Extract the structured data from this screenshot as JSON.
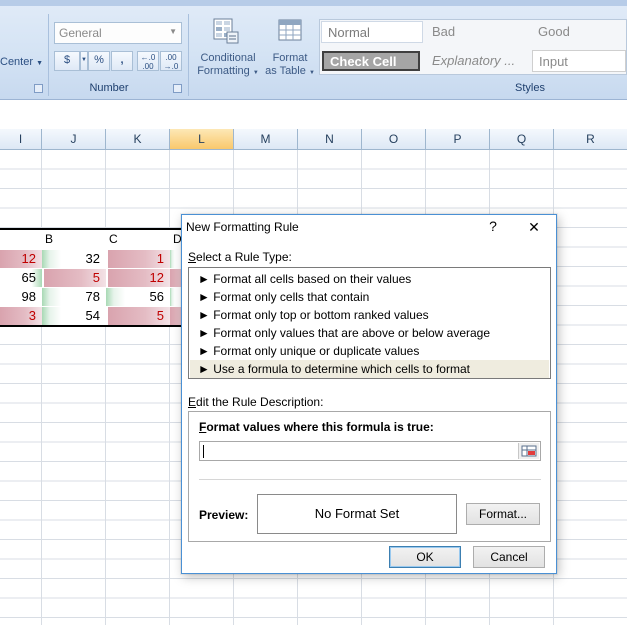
{
  "ribbon": {
    "alignment": {
      "center_label": "Center"
    },
    "number": {
      "format_value": "General",
      "currency_symbol": "$",
      "percent_symbol": "%",
      "comma_symbol": ",",
      "increase_decimal": "←.0 .00",
      "decrease_decimal": ".00 →.0",
      "group_label": "Number"
    },
    "conditional_formatting": {
      "line1": "Conditional",
      "line2": "Formatting"
    },
    "format_as_table": {
      "line1": "Format",
      "line2": "as Table"
    },
    "styles": {
      "normal": "Normal",
      "bad": "Bad",
      "good": "Good",
      "check_cell": "Check Cell",
      "explanatory": "Explanatory ...",
      "input": "Input",
      "group_label": "Styles"
    }
  },
  "sheet": {
    "columns": [
      "I",
      "J",
      "K",
      "L",
      "M",
      "N",
      "O",
      "P",
      "Q",
      "R"
    ],
    "selected_column": "L",
    "table_headers": [
      "B",
      "C",
      "D"
    ],
    "rows": [
      {
        "c1": "12",
        "c2": "32",
        "c3": "1"
      },
      {
        "c1": "65",
        "c2": "5",
        "c3": "12"
      },
      {
        "c1": "98",
        "c2": "78",
        "c3": "56"
      },
      {
        "c1": "3",
        "c2": "54",
        "c3": "5"
      }
    ]
  },
  "dialog": {
    "title": "New Formatting Rule",
    "help": "?",
    "close": "✕",
    "select_rule_label": "Select a Rule Type:",
    "rule_types": [
      "► Format all cells based on their values",
      "► Format only cells that contain",
      "► Format only top or bottom ranked values",
      "► Format only values that are above or below average",
      "► Format only unique or duplicate values",
      "► Use a formula to determine which cells to format"
    ],
    "edit_rule_label": "Edit the Rule Description:",
    "formula_label": "Format values where this formula is true:",
    "formula_value": "",
    "preview_label": "Preview:",
    "preview_text": "No Format Set",
    "format_button": "Format...",
    "ok_button": "OK",
    "cancel_button": "Cancel"
  },
  "colors": {
    "ribbon_bg": "#d4e3f4",
    "red_value": "#c00000",
    "red_bar": "#d9a3ae",
    "green_bar": "#a8d9b4",
    "dialog_border": "#4a90d4",
    "selected_rule_bg": "#efecdf"
  }
}
